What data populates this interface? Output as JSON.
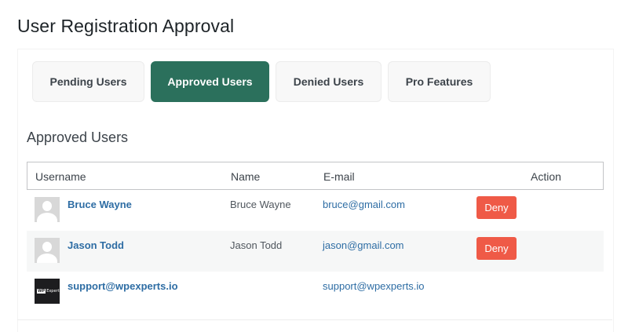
{
  "page": {
    "title": "User Registration Approval"
  },
  "tabs": [
    {
      "label": "Pending Users",
      "active": false
    },
    {
      "label": "Approved Users",
      "active": true
    },
    {
      "label": "Denied Users",
      "active": false
    },
    {
      "label": "Pro Features",
      "active": false
    }
  ],
  "section": {
    "title": "Approved Users"
  },
  "table": {
    "columns": {
      "username": "Username",
      "name": "Name",
      "email": "E-mail",
      "action": "Action"
    },
    "rows": [
      {
        "username": "Bruce Wayne",
        "name": "Bruce Wayne",
        "email": "bruce@gmail.com",
        "action": "Deny",
        "avatar": "default-avatar-icon"
      },
      {
        "username": "Jason Todd",
        "name": "Jason Todd",
        "email": "jason@gmail.com",
        "action": "Deny",
        "avatar": "default-avatar-icon"
      },
      {
        "username": "support@wpexperts.io",
        "name": "",
        "email": "support@wpexperts.io",
        "action": "",
        "avatar": "wpexperts-logo-icon",
        "avatar_text": "WPExperts"
      }
    ]
  },
  "colors": {
    "accent": "#2b705c",
    "deny": "#ef5a47",
    "link": "#2e6da4"
  }
}
